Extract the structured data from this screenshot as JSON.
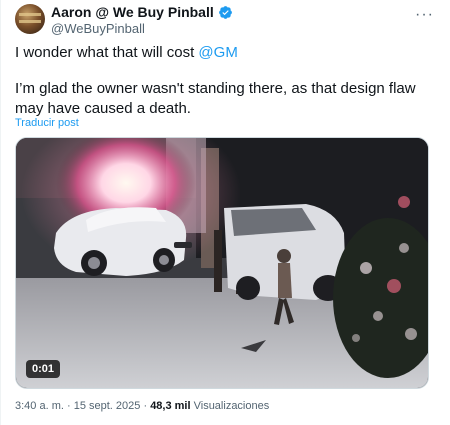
{
  "author": {
    "name": "Aaron @ We Buy Pinball",
    "handle": "@WeBuyPinball",
    "verified": true
  },
  "tweet": {
    "line1_prefix": "I wonder what that will cost ",
    "mention": "@GM",
    "line2": "I’m glad the owner wasn't standing there, as that design flaw may have caused a death.",
    "translate_label": "Traducir post"
  },
  "media": {
    "type": "video",
    "time_badge": "0:01"
  },
  "meta": {
    "time": "3:40 a. m.",
    "separator": "·",
    "date": "15 sept. 2025",
    "views_count": "48,3 mil",
    "views_label": "Visualizaciones"
  },
  "icons": {
    "more": "more-horizontal-icon",
    "verified": "verified-badge-icon"
  },
  "colors": {
    "accent": "#1d9bf0",
    "secondary_text": "#536471",
    "primary_text": "#0f1419"
  }
}
